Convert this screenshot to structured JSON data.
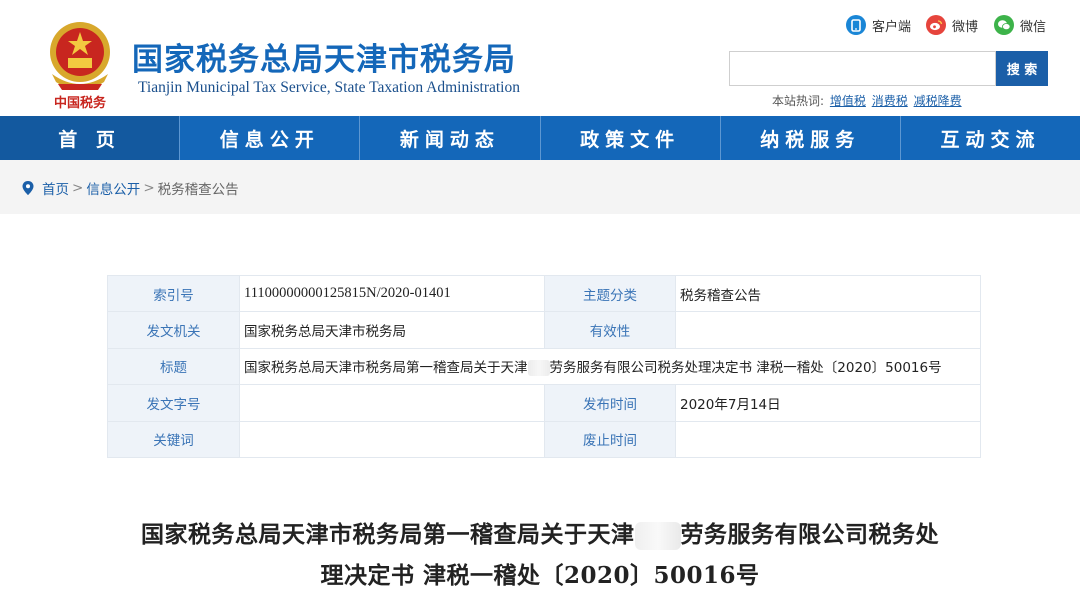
{
  "header": {
    "title_cn": "国家税务总局天津市税务局",
    "title_en": "Tianjin Municipal Tax Service, State Taxation Administration",
    "emblem_text": "中国税务",
    "social": [
      {
        "label": "客户端",
        "icon": "phone-icon"
      },
      {
        "label": "微博",
        "icon": "weibo-icon"
      },
      {
        "label": "微信",
        "icon": "wechat-icon"
      }
    ],
    "search": {
      "placeholder": "",
      "value": "",
      "button_label": "搜 索"
    },
    "hotwords": {
      "label": "本站热词:",
      "items": [
        "增值税",
        "消费税",
        "减税降费"
      ]
    }
  },
  "nav": [
    "首 页",
    "信息公开",
    "新闻动态",
    "政策文件",
    "纳税服务",
    "互动交流"
  ],
  "breadcrumb": {
    "items": [
      "首页",
      "信息公开",
      "税务稽查公告"
    ],
    "separator": ">"
  },
  "meta": {
    "index_label": "索引号",
    "index_value": "11100000000125815N/2020-01401",
    "topic_label": "主题分类",
    "topic_value": "税务稽查公告",
    "issuer_label": "发文机关",
    "issuer_value": "国家税务总局天津市税务局",
    "validity_label": "有效性",
    "validity_value": "",
    "subject_label": "标题",
    "subject_value_before": "国家税务总局天津市税务局第一稽查局关于天津",
    "subject_value_after": "劳务服务有限公司税务处理决定书 津税一稽处〔2020〕50016号",
    "docno_label": "发文字号",
    "docno_value": "",
    "pubdate_label": "发布时间",
    "pubdate_value": "2020年7月14日",
    "keyword_label": "关键词",
    "keyword_value": "",
    "expire_label": "废止时间",
    "expire_value": ""
  },
  "doc_title": {
    "line1_before": "国家税务总局天津市税务局第一稽查局关于天津",
    "line1_after": "劳务服务有限公司税务处",
    "line2": "理决定书 津税一稽处〔2020〕50016号"
  },
  "colors": {
    "brand_blue": "#1467b9",
    "nav_active": "#13599f",
    "search_button": "#1b5fa8",
    "label_cell": "#eef3f9"
  }
}
